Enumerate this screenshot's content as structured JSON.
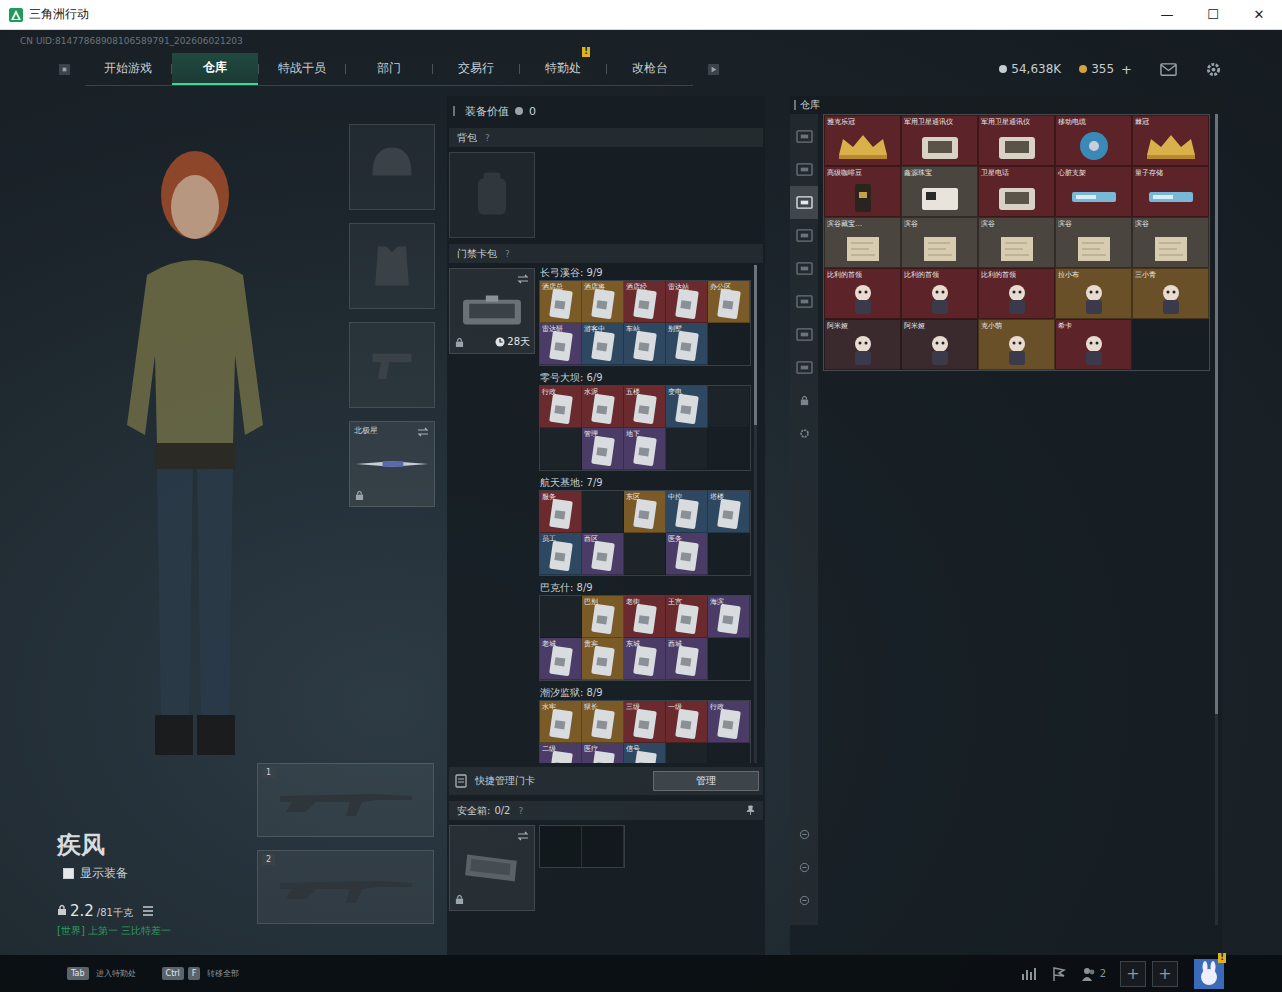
{
  "window": {
    "title": "三角洲行动",
    "controls": [
      "—",
      "☐",
      "✕"
    ]
  },
  "uid": "CN UID:81477868908106589791_202606021203",
  "nav": {
    "tabs": [
      {
        "label": "开始游戏",
        "selected": false,
        "badge": ""
      },
      {
        "label": "仓库",
        "selected": true,
        "badge": ""
      },
      {
        "label": "特战干员",
        "selected": false,
        "badge": ""
      },
      {
        "label": "部门",
        "selected": false,
        "badge": ""
      },
      {
        "label": "交易行",
        "selected": false,
        "badge": ""
      },
      {
        "label": "特勤处",
        "selected": false,
        "badge": "!"
      },
      {
        "label": "改枪台",
        "selected": false,
        "badge": ""
      }
    ],
    "currency": [
      {
        "value": "54,638K",
        "color": "#c8ccd0",
        "add": ""
      },
      {
        "value": "355",
        "color": "#d4a23a",
        "add": "+"
      }
    ]
  },
  "character": {
    "name": "疾风",
    "show_equipment": {
      "label": "显示装备",
      "checked": false
    },
    "weight": "2.2",
    "weight_max": "/81千克",
    "status": "[世界] 上第一 三比特差一"
  },
  "equipment": {
    "melee": {
      "label": "北极星",
      "locked": true
    },
    "weapon_slots": [
      "1",
      "2"
    ]
  },
  "loadout": {
    "value_label": "装备价值",
    "value": "0",
    "backpack": {
      "label": "背包",
      "help": "?"
    },
    "keycard_pack": {
      "label": "门禁卡包",
      "help": "?",
      "days": "28天",
      "locked": true
    },
    "maps": [
      {
        "title": "长弓溪谷: 9/9",
        "slots": [
          {
            "label": "酒店总",
            "owned": true,
            "color": "#7a5a26"
          },
          {
            "label": "酒店将",
            "owned": true,
            "color": "#7a5a26"
          },
          {
            "label": "酒店经",
            "owned": true,
            "color": "#6a2a2e"
          },
          {
            "label": "雷达站",
            "owned": true,
            "color": "#6a2a2e"
          },
          {
            "label": "办公区",
            "owned": true,
            "color": "#7a5a26"
          },
          {
            "label": "雷达研",
            "owned": true,
            "color": "#4a3c66"
          },
          {
            "label": "游客中",
            "owned": true,
            "color": "#2e4862"
          },
          {
            "label": "车站",
            "owned": true,
            "color": "#2e4862"
          },
          {
            "label": "别墅",
            "owned": true,
            "color": "#2e4862"
          }
        ]
      },
      {
        "title": "零号大坝: 6/9",
        "slots": [
          {
            "label": "行政",
            "owned": true,
            "color": "#6a2a2e"
          },
          {
            "label": "水泥",
            "owned": true,
            "color": "#6a2a2e"
          },
          {
            "label": "五楼",
            "owned": true,
            "color": "#6a2a2e"
          },
          {
            "label": "变电",
            "owned": true,
            "color": "#2e4862"
          },
          {
            "label": "",
            "owned": false
          },
          {
            "label": "",
            "owned": false
          },
          {
            "label": "管理",
            "owned": true,
            "color": "#4a3c66"
          },
          {
            "label": "地下",
            "owned": true,
            "color": "#4a3c66"
          },
          {
            "label": "",
            "owned": false
          }
        ]
      },
      {
        "title": "航天基地: 7/9",
        "slots": [
          {
            "label": "服务",
            "owned": true,
            "color": "#6a2a2e"
          },
          {
            "label": "",
            "owned": false
          },
          {
            "label": "东区",
            "owned": true,
            "color": "#7a5a26"
          },
          {
            "label": "中控",
            "owned": true,
            "color": "#2e4862"
          },
          {
            "label": "塔楼",
            "owned": true,
            "color": "#2e4862"
          },
          {
            "label": "员工",
            "owned": true,
            "color": "#2e4862"
          },
          {
            "label": "西区",
            "owned": true,
            "color": "#4a3c66"
          },
          {
            "label": "",
            "owned": false
          },
          {
            "label": "医务",
            "owned": true,
            "color": "#4a3c66"
          }
        ]
      },
      {
        "title": "巴克什: 8/9",
        "slots": [
          {
            "label": "",
            "owned": false
          },
          {
            "label": "巴别",
            "owned": true,
            "color": "#7a5a26"
          },
          {
            "label": "老街",
            "owned": true,
            "color": "#6a2a2e"
          },
          {
            "label": "王宫",
            "owned": true,
            "color": "#6a2a2e"
          },
          {
            "label": "海滨",
            "owned": true,
            "color": "#4a3c66"
          },
          {
            "label": "老城",
            "owned": true,
            "color": "#4a3c66"
          },
          {
            "label": "贵宾",
            "owned": true,
            "color": "#7a5a26"
          },
          {
            "label": "东城",
            "owned": true,
            "color": "#4a3c66"
          },
          {
            "label": "西城",
            "owned": true,
            "color": "#4a3c66"
          }
        ]
      },
      {
        "title": "潮汐监狱: 8/9",
        "slots": [
          {
            "label": "水牢",
            "owned": true,
            "color": "#7a5a26"
          },
          {
            "label": "狱长",
            "owned": true,
            "color": "#7a5a26"
          },
          {
            "label": "三级",
            "owned": true,
            "color": "#6a2a2e"
          },
          {
            "label": "一级",
            "owned": true,
            "color": "#6a2a2e"
          },
          {
            "label": "行政",
            "owned": true,
            "color": "#4a3c66"
          },
          {
            "label": "二级",
            "owned": true,
            "color": "#4a3c66"
          },
          {
            "label": "医疗",
            "owned": true,
            "color": "#4a3c66"
          },
          {
            "label": "信号",
            "owned": true,
            "color": "#2e4862"
          },
          {
            "label": "",
            "owned": false
          }
        ]
      }
    ],
    "quick_manage": {
      "label": "快捷管理门卡",
      "button": "管理"
    },
    "safe_box": {
      "label": "安全箱:",
      "count": "0/2",
      "help": "?",
      "locked": true
    }
  },
  "warehouse": {
    "title": "仓库",
    "sidebar_top": [
      {
        "kind": "tab",
        "selected": false
      },
      {
        "kind": "tab",
        "selected": false
      },
      {
        "kind": "tab",
        "selected": true
      },
      {
        "kind": "tab",
        "selected": false
      },
      {
        "kind": "tab",
        "selected": false
      },
      {
        "kind": "tab",
        "selected": false
      },
      {
        "kind": "tab",
        "selected": false
      },
      {
        "kind": "tab",
        "selected": false
      },
      {
        "kind": "lock",
        "selected": false
      },
      {
        "kind": "settings",
        "selected": false
      }
    ],
    "sidebar_bottom": [
      {
        "kind": "tab",
        "selected": false
      },
      {
        "kind": "tab",
        "selected": false
      },
      {
        "kind": "tab",
        "selected": false
      }
    ],
    "items": [
      {
        "label": "雅克乐冠",
        "kind": "crown",
        "color": "#5c2428"
      },
      {
        "label": "军用卫星通讯仪",
        "kind": "device",
        "color": "#5c2428"
      },
      {
        "label": "军用卫星通讯仪",
        "kind": "device",
        "color": "#5c2428"
      },
      {
        "label": "移动电缆",
        "kind": "cable",
        "color": "#5c2428"
      },
      {
        "label": "棘冠",
        "kind": "crown",
        "color": "#5c2428"
      },
      {
        "label": "高级咖啡豆",
        "kind": "bag",
        "color": "#5c2428"
      },
      {
        "label": "鑫源珠宝",
        "kind": "case",
        "color": "#4a453e"
      },
      {
        "label": "卫星电话",
        "kind": "device",
        "color": "#5c2428"
      },
      {
        "label": "心脏支架",
        "kind": "stick",
        "color": "#5c2428"
      },
      {
        "label": "量子存储",
        "kind": "stick",
        "color": "#5c2428"
      },
      {
        "label": "滨谷藏宝…",
        "kind": "map",
        "color": "#4a453e"
      },
      {
        "label": "滨谷",
        "kind": "map",
        "color": "#4a453e"
      },
      {
        "label": "滨谷",
        "kind": "map",
        "color": "#4a453e"
      },
      {
        "label": "滨谷",
        "kind": "map",
        "color": "#4a453e"
      },
      {
        "label": "滨谷",
        "kind": "map",
        "color": "#4a453e"
      },
      {
        "label": "比利的首领",
        "kind": "doll",
        "color": "#5c2428"
      },
      {
        "label": "比利的首领",
        "kind": "doll",
        "color": "#5c2428"
      },
      {
        "label": "比利的首领",
        "kind": "doll",
        "color": "#5c2428"
      },
      {
        "label": "拉小布",
        "kind": "doll",
        "color": "#6a5028"
      },
      {
        "label": "三小青",
        "kind": "doll",
        "color": "#6a5028"
      },
      {
        "label": "阿米娅",
        "kind": "doll",
        "color": "#3a2a2e"
      },
      {
        "label": "阿米娅",
        "kind": "doll",
        "color": "#3a2a2e"
      },
      {
        "label": "克小萌",
        "kind": "doll",
        "color": "#6a5028"
      },
      {
        "label": "希卡",
        "kind": "doll",
        "color": "#5c2428"
      }
    ]
  },
  "hints": [
    {
      "keys": [
        "Tab"
      ],
      "label": "进入特勤处"
    },
    {
      "keys": [
        "Ctrl",
        "F"
      ],
      "label": "转移全部"
    }
  ],
  "social": {
    "friends": "2",
    "invite": [
      "+",
      "+"
    ],
    "avatar_badge": "!"
  }
}
